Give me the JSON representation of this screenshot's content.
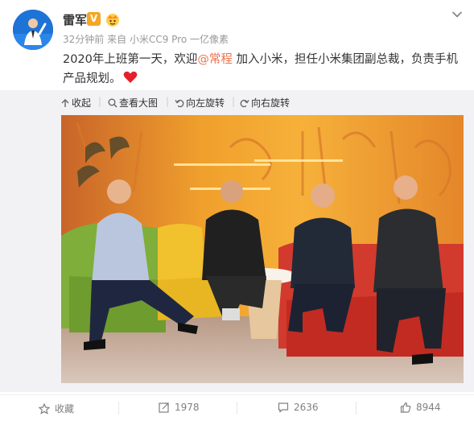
{
  "post": {
    "author": "雷军",
    "verified_mark": "V",
    "time": "32分钟前",
    "source_prefix": "来自",
    "source": "小米CC9 Pro 一亿像素",
    "text_before": "2020年上班第一天，欢迎",
    "mention": "@常程",
    "text_after": " 加入小米，担任小米集团副总裁，负责手机产品规划。",
    "accent_color": "#eb7350"
  },
  "media_toolbar": {
    "collapse": "收起",
    "view_large": "查看大图",
    "rotate_left": "向左旋转",
    "rotate_right": "向右旋转"
  },
  "footer": {
    "favorite": "收藏",
    "repost_count": "1978",
    "comment_count": "2636",
    "like_count": "8944"
  },
  "icons": [
    "chevron-down-icon",
    "crown-icon",
    "heart-emoji-icon",
    "collapse-icon",
    "zoom-icon",
    "rotate-left-icon",
    "rotate-right-icon",
    "star-icon",
    "repost-icon",
    "comment-icon",
    "thumb-up-icon"
  ]
}
